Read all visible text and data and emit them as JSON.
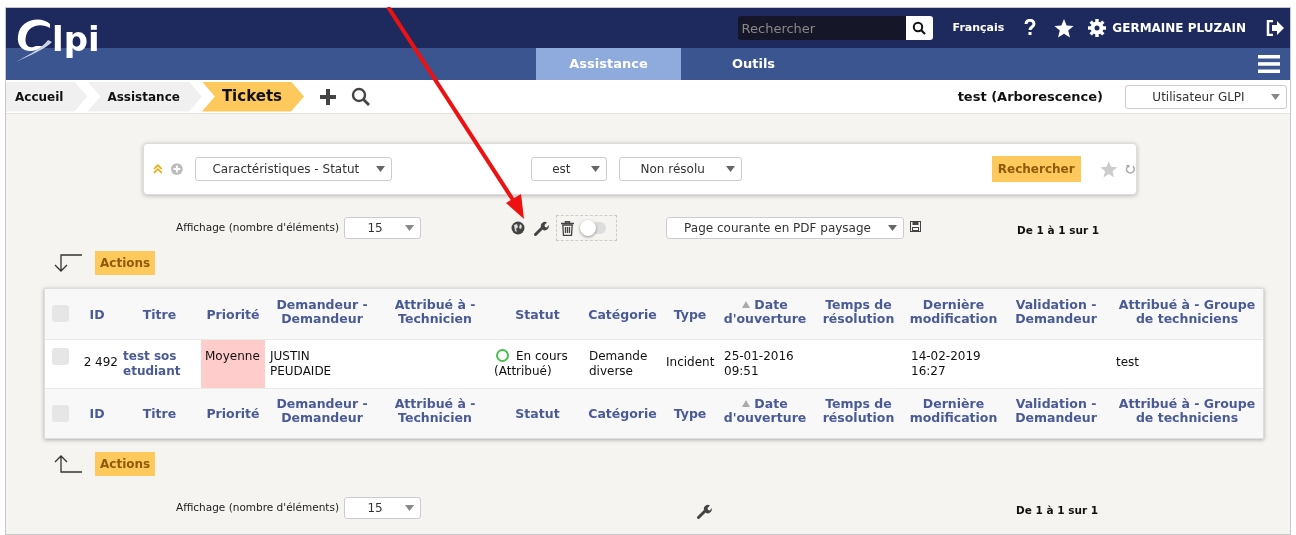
{
  "header": {
    "logo": "lpi",
    "search": {
      "placeholder": "Rechercher"
    },
    "language": "Français",
    "user": "GERMAINE PLUZAIN"
  },
  "menu": [
    {
      "label": "Assistance",
      "selected": true
    },
    {
      "label": "Outils",
      "selected": false
    }
  ],
  "breadcrumb": [
    {
      "label": "Accueil",
      "selected": false
    },
    {
      "label": "Assistance",
      "selected": false
    },
    {
      "label": "Tickets",
      "selected": true
    }
  ],
  "entity": "test (Arborescence)",
  "profile": "Utilisateur GLPI",
  "search_criteria": {
    "field": "Caractéristiques - Statut",
    "operator": "est",
    "value": "Non résolu",
    "button": "Rechercher"
  },
  "top_controls": {
    "display_label": "Affichage (nombre d'éléments)",
    "display_value": "15",
    "toggle_on": false,
    "export": "Page courante en PDF paysage",
    "pager": "De 1 à 1 sur 1"
  },
  "top_actions": "Actions",
  "table": {
    "header_checked": false,
    "footer_checked": false,
    "header_columns": [
      {
        "label": "ID",
        "sorted": false
      },
      {
        "label": "Titre",
        "sorted": false
      },
      {
        "label": "Priorité",
        "sorted": false
      },
      {
        "label": "Demandeur - Demandeur",
        "sorted": false
      },
      {
        "label": "Attribué à - Technicien",
        "sorted": false
      },
      {
        "label": "Statut",
        "sorted": false
      },
      {
        "label": "Catégorie",
        "sorted": false
      },
      {
        "label": "Type",
        "sorted": false
      },
      {
        "label": "Date d'ouverture",
        "sorted": true
      },
      {
        "label": "Temps de résolution",
        "sorted": false
      },
      {
        "label": "Dernière modification",
        "sorted": false
      },
      {
        "label": "Validation - Demandeur",
        "sorted": false
      },
      {
        "label": "Attribué à - Groupe de techniciens",
        "sorted": false
      }
    ],
    "rows": [
      {
        "checked": false,
        "id": "2 492",
        "title": "test sos etudiant",
        "priority": {
          "text": "Moyenne",
          "color": "#ffcccc"
        },
        "requester": "JUSTIN PEUDAIDE",
        "status": {
          "text": "En cours (Attribué)",
          "color": "#49bf4d"
        },
        "category": "Demande diverse",
        "type": "Incident",
        "opened": "25-01-2016 09:51",
        "modified": "14-02-2019 16:27",
        "group": "test"
      }
    ],
    "footer_columns": [
      {
        "label": "ID",
        "sorted": false
      },
      {
        "label": "Titre",
        "sorted": false
      },
      {
        "label": "Priorité",
        "sorted": false
      },
      {
        "label": "Demandeur - Demandeur",
        "sorted": false
      },
      {
        "label": "Attribué à - Technicien",
        "sorted": false
      },
      {
        "label": "Statut",
        "sorted": false
      },
      {
        "label": "Catégorie",
        "sorted": false
      },
      {
        "label": "Type",
        "sorted": false
      },
      {
        "label": "Date d'ouverture",
        "sorted": true
      },
      {
        "label": "Temps de résolution",
        "sorted": false
      },
      {
        "label": "Dernière modification",
        "sorted": false
      },
      {
        "label": "Validation - Demandeur",
        "sorted": false
      },
      {
        "label": "Attribué à - Groupe de techniciens",
        "sorted": false
      }
    ]
  },
  "bottom_actions": "Actions",
  "bottom_controls": {
    "display_label": "Affichage (nombre d'éléments)",
    "display_value": "15",
    "pager": "De 1 à 1 sur 1"
  }
}
